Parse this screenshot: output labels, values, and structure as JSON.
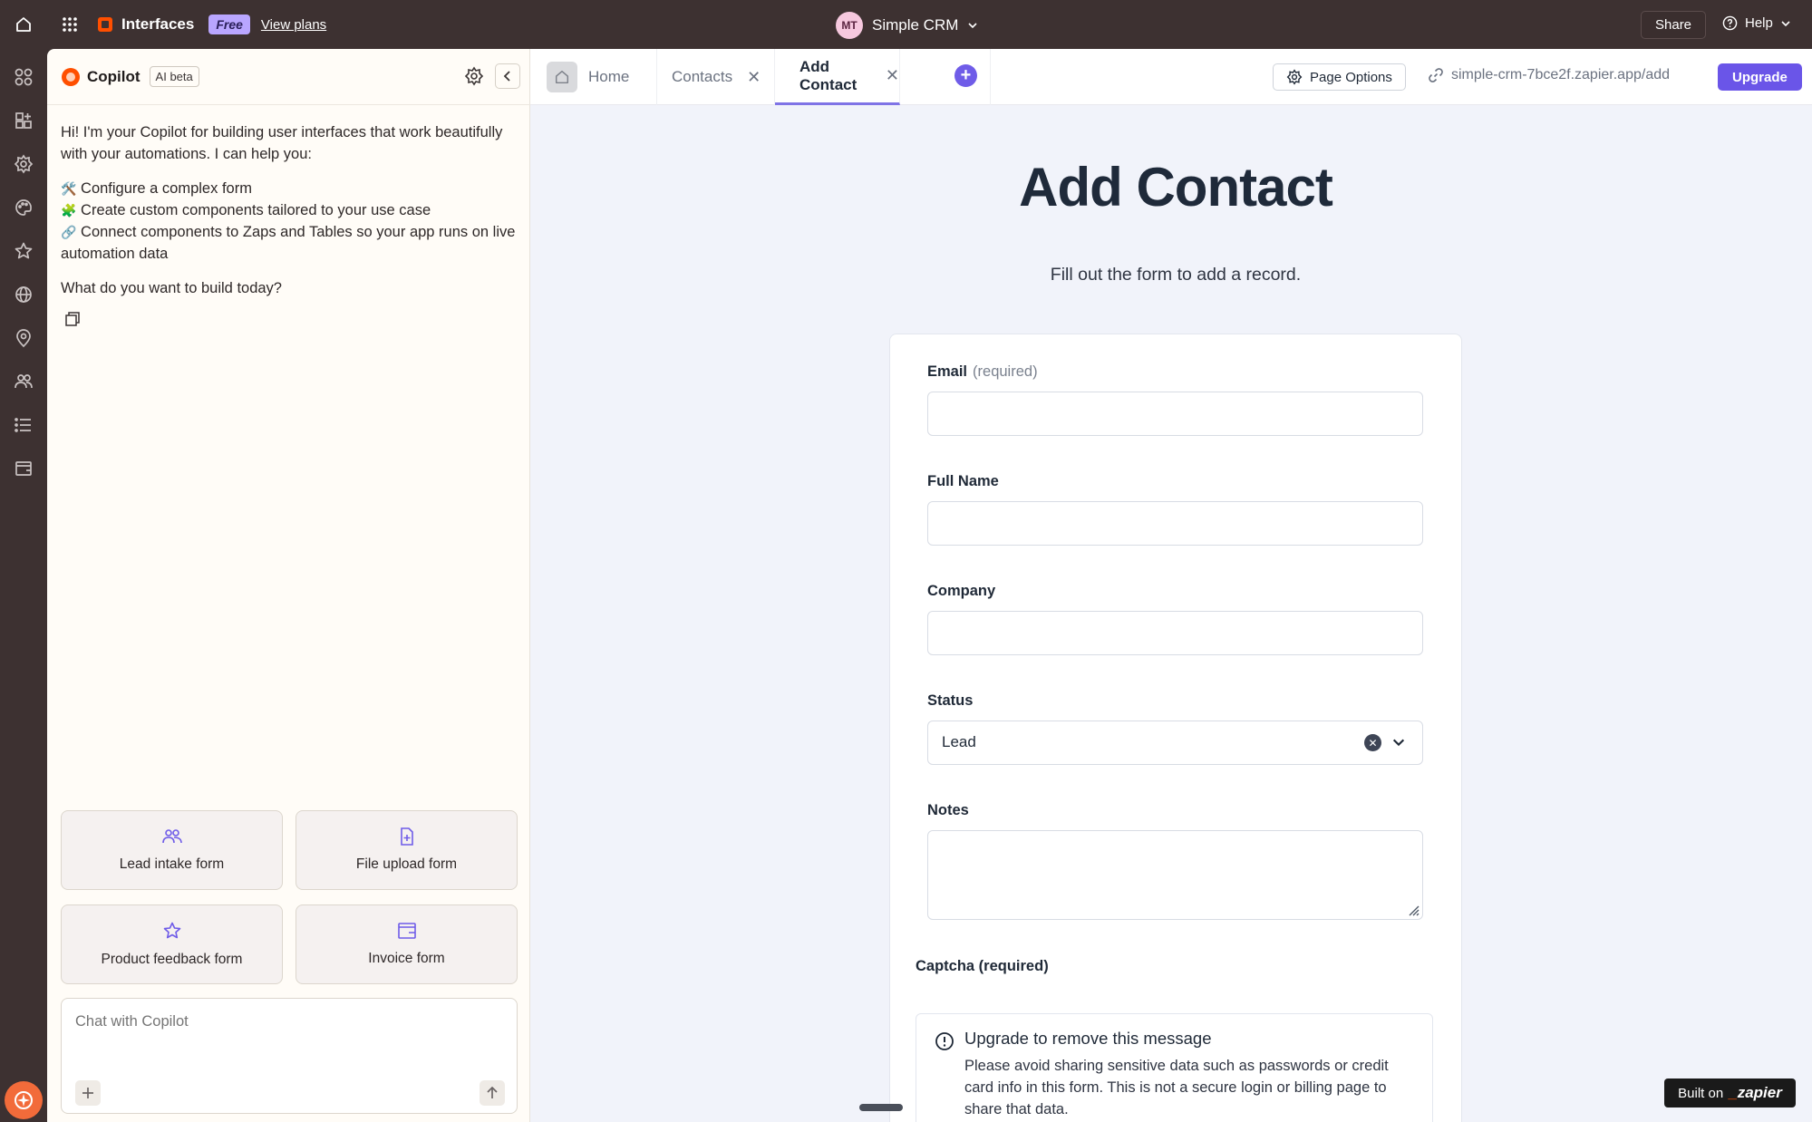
{
  "topbar": {
    "brand": "Interfaces",
    "plan_badge": "Free",
    "view_plans": "View plans",
    "avatar_initials": "MT",
    "app_name": "Simple CRM",
    "share": "Share",
    "help": "Help"
  },
  "copilot": {
    "title": "Copilot",
    "badge": "AI beta",
    "intro": "Hi! I'm your Copilot for building user interfaces that work beautifully with your automations. I can help you:",
    "capabilities": [
      {
        "emoji": "🛠️",
        "text": "Configure a complex form"
      },
      {
        "emoji": "🧩",
        "text": "Create custom components tailored to your use case"
      },
      {
        "emoji": "🔗",
        "text": "Connect components to Zaps and Tables so your app runs on live automation data"
      }
    ],
    "question": "What do you want to build today?",
    "suggestions": [
      {
        "label": "Lead intake form",
        "icon": "users-icon"
      },
      {
        "label": "File upload form",
        "icon": "file-plus-icon"
      },
      {
        "label": "Product feedback form",
        "icon": "star-icon"
      },
      {
        "label": "Invoice form",
        "icon": "wallet-icon"
      }
    ],
    "chat_placeholder": "Chat with Copilot"
  },
  "tabs": {
    "home": "Home",
    "contacts": "Contacts",
    "add_contact": "Add Contact",
    "page_options": "Page Options",
    "url": "simple-crm-7bce2f.zapier.app/add",
    "upgrade": "Upgrade"
  },
  "page": {
    "title": "Add Contact",
    "subtitle": "Fill out the form to add a record."
  },
  "form": {
    "email_label": "Email",
    "email_req": "(required)",
    "fullname_label": "Full Name",
    "company_label": "Company",
    "status_label": "Status",
    "status_value": "Lead",
    "notes_label": "Notes",
    "captcha_label": "Captcha (required)",
    "notice_title": "Upgrade to remove this message",
    "notice_body": "Please avoid sharing sensitive data such as passwords or credit card info in this form. This is not a secure login or billing page to share that data."
  },
  "footer": {
    "built_on": "Built on",
    "zapier": "zapier"
  },
  "colors": {
    "accent": "#6a55e8",
    "topbar": "#3d3131",
    "brand_orange": "#ff4f00",
    "page_bg": "#f1f3fa"
  }
}
